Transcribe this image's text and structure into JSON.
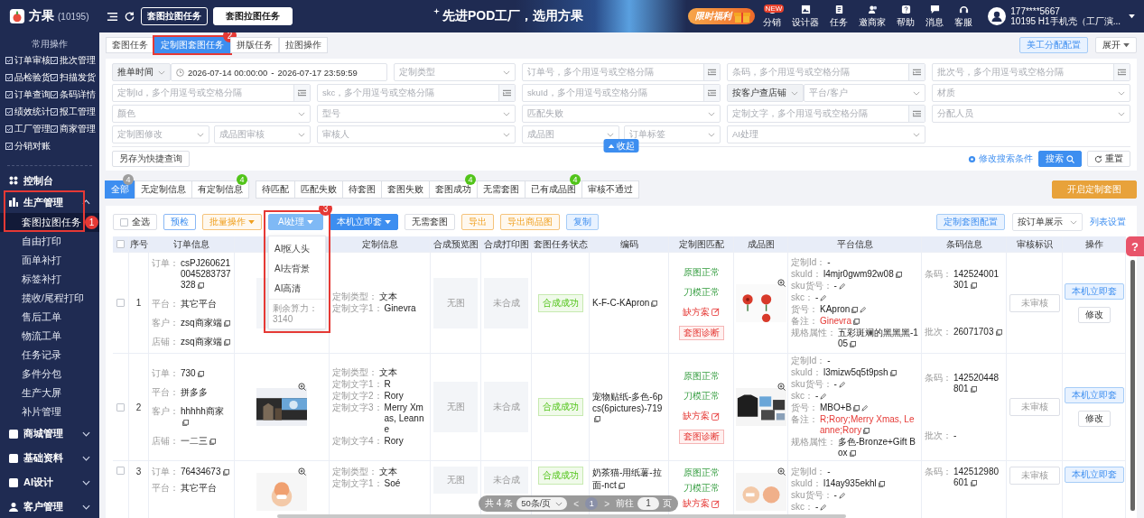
{
  "header": {
    "logo": "方果",
    "account": "(10195)",
    "page_tabs": [
      {
        "label": "套图拉图任务",
        "selected": false
      },
      {
        "label": "套图拉图任务",
        "selected": true
      }
    ],
    "slogan": "先进POD工厂，选用方果",
    "promo": "限时福利",
    "tools": [
      {
        "label": "分销",
        "badge": "NEW"
      },
      {
        "label": "设计器"
      },
      {
        "label": "任务"
      },
      {
        "label": "邀商家"
      },
      {
        "label": "帮助"
      },
      {
        "label": "消息"
      },
      {
        "label": "客服"
      }
    ],
    "user": {
      "phone": "177****5667",
      "org": "10195 H1手机壳（工厂演..."
    }
  },
  "sidebar": {
    "quick_title": "常用操作",
    "quick": [
      "订单审核",
      "批次管理",
      "品检验货",
      "扫描发货",
      "订单查询",
      "条码详情",
      "绩效统计",
      "报工管理",
      "工厂管理",
      "商家管理",
      "分销对账"
    ],
    "menu": [
      {
        "label": "控制台"
      },
      {
        "label": "生产管理",
        "expanded": true,
        "children": [
          {
            "label": "套图拉图任务",
            "selected": true,
            "callout": "1"
          },
          {
            "label": "自由打印",
            "selected": false
          },
          {
            "label": "面单补打",
            "selected": false
          },
          {
            "label": "标签补打",
            "selected": false
          },
          {
            "label": "揽收/尾程打印",
            "selected": false
          },
          {
            "label": "售后工单",
            "selected": false
          },
          {
            "label": "物流工单",
            "selected": false
          },
          {
            "label": "任务记录",
            "selected": false
          },
          {
            "label": "多件分包",
            "selected": false
          },
          {
            "label": "生产大屏",
            "selected": false
          },
          {
            "label": "补片管理",
            "selected": false
          }
        ]
      },
      {
        "label": "商城管理",
        "expanded": false
      },
      {
        "label": "基础资料",
        "expanded": false
      },
      {
        "label": "AI设计",
        "expanded": false
      },
      {
        "label": "客户管理",
        "expanded": false
      }
    ]
  },
  "subtabs": [
    {
      "label": "套图任务",
      "selected": false
    },
    {
      "label": "定制图套图任务",
      "selected": true,
      "callout": "2"
    },
    {
      "label": "拼版任务",
      "selected": false
    },
    {
      "label": "拉图操作",
      "selected": false
    }
  ],
  "top_actions": {
    "assign": "美工分配配置",
    "expand": "展开"
  },
  "filters": {
    "rows": [
      [
        {
          "kind": "date",
          "prefix": "推单时间",
          "start": "2026-07-14 00:00:00",
          "separator": "-",
          "end": "2026-07-17 23:59:59"
        },
        {
          "kind": "select",
          "placeholder": "定制类型"
        },
        {
          "kind": "input",
          "placeholder": "订单号，多个用逗号或空格分隔"
        },
        {
          "kind": "input",
          "placeholder": "条码，多个用逗号或空格分隔"
        },
        {
          "kind": "input",
          "placeholder": "批次号，多个用逗号或空格分隔"
        }
      ],
      [
        {
          "kind": "input",
          "placeholder": "定制Id，多个用逗号或空格分隔"
        },
        {
          "kind": "input",
          "placeholder": "skc，多个用逗号或空格分隔"
        },
        {
          "kind": "input",
          "placeholder": "skuId，多个用逗号或空格分隔"
        },
        {
          "kind": "combo",
          "prefix": "按客户查店铺",
          "placeholder": "平台/客户"
        },
        {
          "kind": "select",
          "placeholder": "材质"
        }
      ],
      [
        {
          "kind": "select",
          "placeholder": "颜色"
        },
        {
          "kind": "select",
          "placeholder": "型号"
        },
        {
          "kind": "select",
          "placeholder": "匹配失败"
        },
        {
          "kind": "input",
          "placeholder": "定制文字，多个用逗号或空格分隔"
        },
        {
          "kind": "select",
          "placeholder": "分配人员"
        }
      ],
      [
        {
          "kind": "pair",
          "fields": [
            {
              "kind": "select",
              "placeholder": "定制图修改"
            },
            {
              "kind": "select",
              "placeholder": "成品图审核"
            }
          ]
        },
        {
          "kind": "select",
          "placeholder": "审核人"
        },
        {
          "kind": "pair",
          "fields": [
            {
              "kind": "select",
              "placeholder": "成品图"
            },
            {
              "kind": "select",
              "placeholder": "订单标签"
            }
          ]
        },
        {
          "kind": "select",
          "placeholder": "AI处理"
        }
      ]
    ],
    "save_query": "另存为快捷查询",
    "collapse": "收起",
    "edit_conditions": "修改搜索条件",
    "search": "搜索",
    "reset": "重置"
  },
  "status_tabs": {
    "groups": [
      [
        {
          "label": "全部",
          "selected": true,
          "badge": "4",
          "color": "#9e9e9e"
        },
        {
          "label": "无定制信息",
          "selected": false
        },
        {
          "label": "有定制信息",
          "selected": false,
          "badge": "4",
          "color": "#52c41a"
        }
      ],
      [
        {
          "label": "待匹配",
          "selected": false
        },
        {
          "label": "匹配失败",
          "selected": false
        },
        {
          "label": "待套图",
          "selected": false
        },
        {
          "label": "套图失败",
          "selected": false
        },
        {
          "label": "套图成功",
          "selected": false,
          "badge": "4",
          "color": "#52c41a"
        },
        {
          "label": "无需套图",
          "selected": false
        },
        {
          "label": "已有成品图",
          "selected": false,
          "badge": "4",
          "color": "#52c41a"
        },
        {
          "label": "审核不通过",
          "selected": false
        }
      ]
    ],
    "start": "开启定制套图"
  },
  "toolbar": {
    "buttons": [
      {
        "kind": "select-all",
        "label": "全选",
        "checked": false
      },
      {
        "kind": "outline-blue",
        "label": "预检"
      },
      {
        "kind": "outline-orange",
        "label": "批量操作",
        "caret": true
      },
      {
        "kind": "ai",
        "label": "AI处理",
        "caret": true
      },
      {
        "kind": "primary",
        "label": "本机立即套",
        "caret": true
      },
      {
        "kind": "plain",
        "label": "无需套图"
      },
      {
        "kind": "outline-orange",
        "label": "导出"
      },
      {
        "kind": "outline-orange",
        "label": "导出商品图"
      },
      {
        "kind": "light-blue",
        "label": "复制"
      }
    ],
    "config": "定制套图配置",
    "view": "按订单展示",
    "list_settings": "列表设置"
  },
  "ai_menu": {
    "callout": "3",
    "items": [
      "AI抠人头",
      "AI去背景",
      "AI高清"
    ],
    "quota": "剩余算力：3140"
  },
  "table": {
    "header_checked": false,
    "columns": [
      "序号",
      "订单信息",
      "",
      "定制信息",
      "合成预览图",
      "合成打印图",
      "套图任务状态",
      "编码",
      "定制图匹配",
      "成品图",
      "平台信息",
      "条码信息",
      "审核标识",
      "操作"
    ],
    "rows": [
      {
        "checked": false,
        "index": "1",
        "order": [
          {
            "label": "订单：",
            "value": "csPJ2606210045283737328",
            "copy": true
          },
          {
            "label": "平台：",
            "value": "其它平台"
          },
          {
            "label": "客户：",
            "value": "zsq商家端",
            "copy": true
          },
          {
            "label": "店铺：",
            "value": "zsq商家端",
            "copy": true
          }
        ],
        "design_image": {
          "kind": "placeholder"
        },
        "custom": [
          {
            "label": "定制类型：",
            "value": "文本"
          },
          {
            "label": "定制文字1：",
            "value": "Ginevra"
          }
        ],
        "preview": "无图",
        "print": "未合成",
        "status": "合成成功",
        "code": "K-F-C-KApron",
        "match": [
          {
            "text": "原图正常",
            "kind": "ok"
          },
          {
            "text": "刀模正常",
            "kind": "ok"
          },
          {
            "text": "缺方案",
            "kind": "missing"
          }
        ],
        "diagnose": "套图诊断",
        "product_image": {
          "kind": "picture"
        },
        "platform": [
          {
            "label": "定制Id：",
            "value": "-"
          },
          {
            "label": "skuId：",
            "value": "l4mjr0gwm92w08",
            "copy": true
          },
          {
            "label": "sku货号：",
            "value": "-",
            "edit": true
          },
          {
            "label": "skc：",
            "value": "-",
            "edit": true
          },
          {
            "label": "货号：",
            "value": "KApron",
            "copy": true,
            "edit": true
          },
          {
            "label": "备注：",
            "value": "Ginevra",
            "copy": true,
            "alert": true
          },
          {
            "label": "规格属性：",
            "value": "五彩斑斓的黑黑黑-105",
            "copy": true
          }
        ],
        "barcode": [
          {
            "label": "条码：",
            "value": "142524001301",
            "copy": true
          },
          {
            "label": "批次：",
            "value": "26071703",
            "copy": true
          }
        ],
        "review": "未审核",
        "actions": [
          "本机立即套",
          "修改"
        ]
      },
      {
        "checked": false,
        "index": "2",
        "order": [
          {
            "label": "订单：",
            "value": "730",
            "copy": true
          },
          {
            "label": "平台：",
            "value": "拼多多"
          },
          {
            "label": "客户：",
            "value": "hhhhh商家",
            "copy": true
          },
          {
            "label": "店铺：",
            "value": "一二三",
            "copy": true
          }
        ],
        "design_image": {
          "kind": "picture"
        },
        "custom": [
          {
            "label": "定制类型：",
            "value": "文本"
          },
          {
            "label": "定制文字1：",
            "value": "R"
          },
          {
            "label": "定制文字2：",
            "value": "Rory"
          },
          {
            "label": "定制文字3：",
            "value": "Merry Xmas, Leanne"
          },
          {
            "label": "定制文字4：",
            "value": "Rory"
          }
        ],
        "preview": "无图",
        "print": "未合成",
        "status": "合成成功",
        "code": "宠物贴纸-多色-6pcs(6pictures)-719",
        "match": [
          {
            "text": "原图正常",
            "kind": "ok"
          },
          {
            "text": "刀模正常",
            "kind": "ok"
          },
          {
            "text": "缺方案",
            "kind": "missing"
          }
        ],
        "diagnose": "套图诊断",
        "product_image": {
          "kind": "picture"
        },
        "platform": [
          {
            "label": "定制Id：",
            "value": "-"
          },
          {
            "label": "skuId：",
            "value": "l3mizw5q5t9psh",
            "copy": true
          },
          {
            "label": "sku货号：",
            "value": "-",
            "edit": true
          },
          {
            "label": "skc：",
            "value": "-",
            "edit": true
          },
          {
            "label": "货号：",
            "value": "MBO+B",
            "copy": true,
            "edit": true
          },
          {
            "label": "备注：",
            "value": "R;Rory;Merry Xmas, Leanne;Rory",
            "copy": true,
            "alert": true
          },
          {
            "label": "规格属性：",
            "value": "多色-Bronze+Gift Box",
            "copy": true
          }
        ],
        "barcode": [
          {
            "label": "条码：",
            "value": "142520448801",
            "copy": true
          },
          {
            "label": "批次：",
            "value": "-"
          }
        ],
        "review": "未审核",
        "actions": [
          "本机立即套",
          "修改"
        ]
      },
      {
        "checked": false,
        "index": "3",
        "order": [
          {
            "label": "订单：",
            "value": "76434673",
            "copy": true
          },
          {
            "label": "平台：",
            "value": "其它平台"
          }
        ],
        "design_image": {
          "kind": "picture"
        },
        "custom": [
          {
            "label": "定制类型：",
            "value": "文本"
          },
          {
            "label": "定制文字1：",
            "value": "Soé"
          }
        ],
        "preview": "无图",
        "print": "未合成",
        "status": "合成成功",
        "code": "奶茶猫-用纸薯-拉面-nct",
        "match": [
          {
            "text": "原图正常",
            "kind": "ok"
          },
          {
            "text": "刀模正常",
            "kind": "ok"
          },
          {
            "text": "缺方案",
            "kind": "missing"
          }
        ],
        "product_image": {
          "kind": "picture"
        },
        "platform": [
          {
            "label": "定制Id：",
            "value": "-"
          },
          {
            "label": "skuId：",
            "value": "l14ay935ekhl",
            "copy": true
          },
          {
            "label": "sku货号：",
            "value": "-",
            "edit": true
          },
          {
            "label": "skc：",
            "value": "-",
            "edit": true
          }
        ],
        "barcode": [
          {
            "label": "条码：",
            "value": "142512980601",
            "copy": true
          }
        ],
        "review": "未审核",
        "actions": [
          "本机立即套"
        ]
      }
    ]
  },
  "pagination": {
    "total": "共 4 条",
    "page_size": "50条/页",
    "prev": "<",
    "page": "1",
    "next": ">",
    "goto": "前往",
    "goto_value": "1",
    "unit": "页"
  },
  "help_button": "?"
}
